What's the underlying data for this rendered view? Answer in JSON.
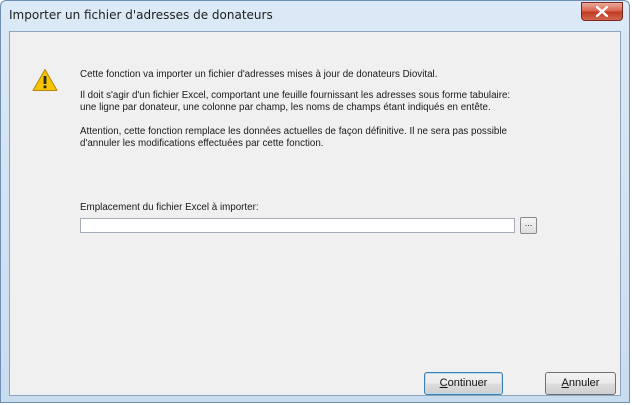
{
  "window": {
    "title": "Importer un fichier d'adresses de donateurs",
    "close_label": "✕"
  },
  "message": {
    "icon": "warning-icon",
    "p1": "Cette fonction va importer un fichier d'adresses mises à jour de donateurs Diovital.",
    "p2_line1": "Il doit s'agir d'un fichier Excel, comportant une feuille fournissant les adresses sous forme tabulaire:",
    "p2_line2": "une ligne par donateur, une colonne par champ, les noms de champs étant indiqués en entête.",
    "p3_line1": "Attention, cette fonction remplace les données actuelles de façon définitive. Il ne sera pas possible",
    "p3_line2": "d'annuler les modifications effectuées par cette fonction."
  },
  "file": {
    "label": "Emplacement du fichier Excel à importer:",
    "value": "",
    "browse_label": "..."
  },
  "buttons": {
    "continue_first": "C",
    "continue_rest": "ontinuer",
    "cancel_first": "A",
    "cancel_rest": "nnuler"
  },
  "colors": {
    "titlebar": "#c9dcef",
    "close": "#c0391f",
    "client": "#f0f0f0",
    "warning": "#f5c400"
  }
}
